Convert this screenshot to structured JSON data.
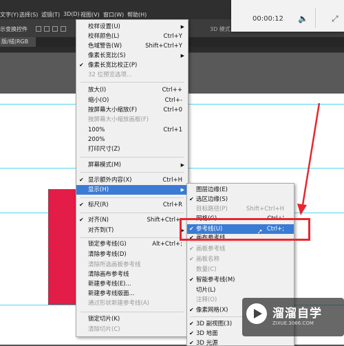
{
  "menubar": {
    "items": [
      "文字(Y)",
      "选择(S)",
      "滤镜(T)",
      "3D(D)",
      "视图(V)",
      "窗口(W)",
      "帮助(H)"
    ]
  },
  "options_bar": {
    "label": "示变换控件",
    "mode_label": "3D 模式："
  },
  "doc_tab": {
    "label": "版/绒(RGB"
  },
  "video": {
    "time": "00:00:12",
    "volume_icon": "🔈",
    "expand_icon": "⤢"
  },
  "view_menu": {
    "items": [
      {
        "label": "校样设置(U)",
        "shortcut": "",
        "submenu": true,
        "disabled": false,
        "checked": false
      },
      {
        "label": "校样颜色(L)",
        "shortcut": "Ctrl+Y",
        "submenu": false,
        "disabled": false,
        "checked": false
      },
      {
        "label": "色域警告(W)",
        "shortcut": "Shift+Ctrl+Y",
        "submenu": false,
        "disabled": false,
        "checked": false
      },
      {
        "label": "像素长宽比(S)",
        "shortcut": "",
        "submenu": true,
        "disabled": false,
        "checked": false
      },
      {
        "label": "像素长宽比校正(P)",
        "shortcut": "",
        "submenu": false,
        "disabled": false,
        "checked": true
      },
      {
        "label": "32 位预览选项...",
        "shortcut": "",
        "submenu": false,
        "disabled": true,
        "checked": false
      },
      {
        "label": "放大(I)",
        "shortcut": "Ctrl++",
        "submenu": false,
        "disabled": false,
        "checked": false
      },
      {
        "label": "缩小(O)",
        "shortcut": "Ctrl+-",
        "submenu": false,
        "disabled": false,
        "checked": false
      },
      {
        "label": "按屏幕大小缩放(F)",
        "shortcut": "Ctrl+0",
        "submenu": false,
        "disabled": false,
        "checked": false
      },
      {
        "label": "按屏幕大小缩放画板(F)",
        "shortcut": "",
        "submenu": false,
        "disabled": true,
        "checked": false
      },
      {
        "label": "100%",
        "shortcut": "Ctrl+1",
        "submenu": false,
        "disabled": false,
        "checked": false
      },
      {
        "label": "200%",
        "shortcut": "",
        "submenu": false,
        "disabled": false,
        "checked": false
      },
      {
        "label": "打印尺寸(Z)",
        "shortcut": "",
        "submenu": false,
        "disabled": false,
        "checked": false
      },
      {
        "label": "屏幕模式(M)",
        "shortcut": "",
        "submenu": true,
        "disabled": false,
        "checked": false
      },
      {
        "label": "显示额外内容(X)",
        "shortcut": "Ctrl+H",
        "submenu": false,
        "disabled": false,
        "checked": true
      },
      {
        "label": "显示(H)",
        "shortcut": "",
        "submenu": true,
        "disabled": false,
        "checked": false,
        "highlighted": true
      },
      {
        "label": "标尺(R)",
        "shortcut": "Ctrl+R",
        "submenu": false,
        "disabled": false,
        "checked": true
      },
      {
        "label": "对齐(N)",
        "shortcut": "Shift+Ctrl+;",
        "submenu": false,
        "disabled": false,
        "checked": true
      },
      {
        "label": "对齐到(T)",
        "shortcut": "",
        "submenu": true,
        "disabled": false,
        "checked": false
      },
      {
        "label": "锁定参考线(G)",
        "shortcut": "Alt+Ctrl+;",
        "submenu": false,
        "disabled": false,
        "checked": false
      },
      {
        "label": "清除参考线(D)",
        "shortcut": "",
        "submenu": false,
        "disabled": false,
        "checked": false
      },
      {
        "label": "清除所选画板参考线",
        "shortcut": "",
        "submenu": false,
        "disabled": true,
        "checked": false
      },
      {
        "label": "清除画布参考线",
        "shortcut": "",
        "submenu": false,
        "disabled": false,
        "checked": false
      },
      {
        "label": "新建参考线(E)...",
        "shortcut": "",
        "submenu": false,
        "disabled": false,
        "checked": false
      },
      {
        "label": "新建参考线版面...",
        "shortcut": "",
        "submenu": false,
        "disabled": false,
        "checked": false
      },
      {
        "label": "通过形状新建参考线(A)",
        "shortcut": "",
        "submenu": false,
        "disabled": true,
        "checked": false
      },
      {
        "label": "锁定切片(K)",
        "shortcut": "",
        "submenu": false,
        "disabled": false,
        "checked": false
      },
      {
        "label": "清除切片(C)",
        "shortcut": "",
        "submenu": false,
        "disabled": true,
        "checked": false
      }
    ]
  },
  "show_submenu": {
    "items": [
      {
        "label": "图层边缘(E)",
        "shortcut": "",
        "checked": false,
        "disabled": false
      },
      {
        "label": "选区边缘(S)",
        "shortcut": "",
        "checked": true,
        "disabled": false
      },
      {
        "label": "目标路径(P)",
        "shortcut": "Shift+Ctrl+H",
        "checked": false,
        "disabled": true
      },
      {
        "label": "网格(G)",
        "shortcut": "Ctrl+'",
        "checked": false,
        "disabled": false
      },
      {
        "label": "参考线(U)",
        "shortcut": "Ctrl+;",
        "checked": true,
        "disabled": false,
        "highlighted": true
      },
      {
        "label": "画布参考线",
        "shortcut": "",
        "checked": true,
        "disabled": false
      },
      {
        "label": "画板参考线",
        "shortcut": "",
        "checked": true,
        "disabled": true
      },
      {
        "label": "画板名称",
        "shortcut": "",
        "checked": true,
        "disabled": true
      },
      {
        "label": "数量(C)",
        "shortcut": "",
        "checked": false,
        "disabled": true
      },
      {
        "label": "智能参考线(M)",
        "shortcut": "",
        "checked": true,
        "disabled": false
      },
      {
        "label": "切片(L)",
        "shortcut": "",
        "checked": false,
        "disabled": false
      },
      {
        "label": "注释(O)",
        "shortcut": "",
        "checked": false,
        "disabled": true
      },
      {
        "label": "像素网格(X)",
        "shortcut": "",
        "checked": true,
        "disabled": false
      },
      {
        "label": "3D 副视图(3)",
        "shortcut": "",
        "checked": true,
        "disabled": false
      },
      {
        "label": "3D 地面",
        "shortcut": "",
        "checked": true,
        "disabled": false
      },
      {
        "label": "3D 光源",
        "shortcut": "",
        "checked": true,
        "disabled": false
      }
    ]
  },
  "watermark": {
    "title": "溜溜自学",
    "url": "ZIXUE.3066.COM"
  },
  "colors": {
    "annotation_red": "#e8262e",
    "highlight_blue": "#3a7bd5",
    "guide_cyan": "#4fd6ee",
    "shape_red": "#e31c48"
  }
}
